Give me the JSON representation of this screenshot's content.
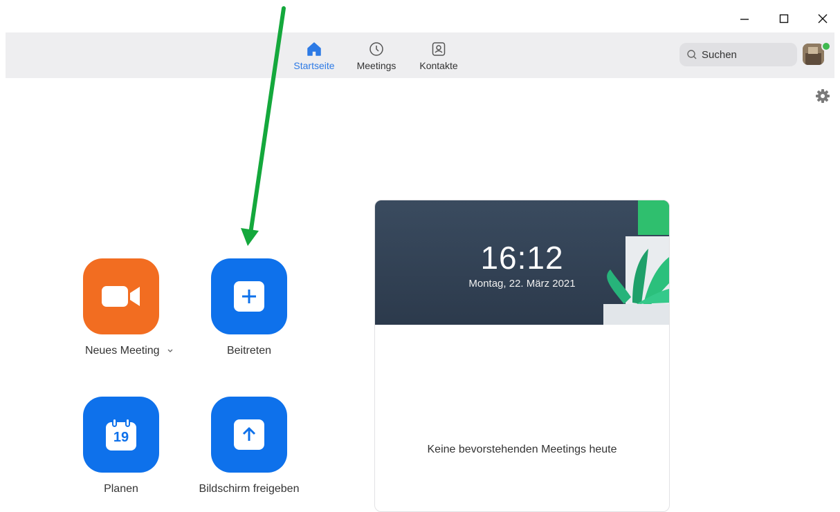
{
  "window": {
    "controls": [
      "minimize-icon",
      "maximize-icon",
      "close-icon"
    ]
  },
  "nav": {
    "tabs": [
      {
        "label": "Startseite",
        "icon": "home-icon",
        "active": true
      },
      {
        "label": "Meetings",
        "icon": "clock-icon",
        "active": false
      },
      {
        "label": "Kontakte",
        "icon": "contact-card-icon",
        "active": false
      }
    ],
    "search_placeholder": "Suchen"
  },
  "actions": {
    "new_meeting": {
      "label": "Neues Meeting",
      "icon": "video-camera-icon",
      "dropdown": "chevron-down-icon"
    },
    "join": {
      "label": "Beitreten",
      "icon": "plus-icon"
    },
    "schedule": {
      "label": "Planen",
      "icon": "calendar-icon",
      "calendar_day": "19"
    },
    "share_screen": {
      "label": "Bildschirm freigeben",
      "icon": "upload-arrow-icon"
    }
  },
  "meeting_card": {
    "time": "16:12",
    "date": "Montag, 22. März 2021",
    "empty_message": "Keine bevorstehenden Meetings heute"
  },
  "colors": {
    "accent": "#0e71eb",
    "orange": "#f26d21",
    "annotation_arrow": "#14a83c",
    "status_online": "#3fb950"
  }
}
